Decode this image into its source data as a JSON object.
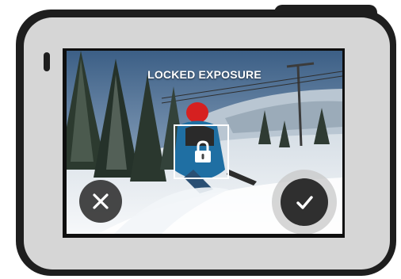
{
  "screen": {
    "title": "LOCKED EXPOSURE"
  },
  "controls": {
    "cancel_icon": "close-icon",
    "confirm_icon": "checkmark-icon",
    "exposure_lock_icon": "lock-icon"
  },
  "colors": {
    "device_body": "#1e1e1e",
    "device_bezel": "#d6d6d6",
    "overlay_text": "#ffffff",
    "button_fill": "#2f2f2f"
  }
}
